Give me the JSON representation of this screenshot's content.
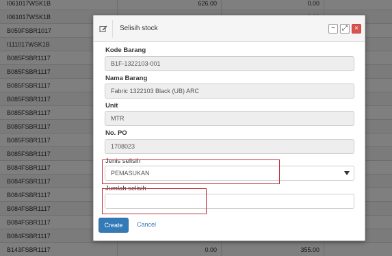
{
  "background": {
    "rows": [
      {
        "code": "I061017WSK1B",
        "v1": "626.00",
        "v2": "0.00"
      },
      {
        "code": "I061017WSK1B",
        "v1": "",
        "v2": "0.00"
      },
      {
        "code": "B059FSBR1017",
        "v1": "",
        "v2": ""
      },
      {
        "code": "I111017WSK1B",
        "v1": "",
        "v2": ""
      },
      {
        "code": "B085FSBR1117",
        "v1": "",
        "v2": ""
      },
      {
        "code": "B085FSBR1117",
        "v1": "",
        "v2": ""
      },
      {
        "code": "B085FSBR1117",
        "v1": "",
        "v2": ""
      },
      {
        "code": "B085FSBR1117",
        "v1": "",
        "v2": ""
      },
      {
        "code": "B085FSBR1117",
        "v1": "",
        "v2": ""
      },
      {
        "code": "B085FSBR1117",
        "v1": "",
        "v2": ""
      },
      {
        "code": "B085FSBR1117",
        "v1": "",
        "v2": ""
      },
      {
        "code": "B085FSBR1117",
        "v1": "",
        "v2": ""
      },
      {
        "code": "B084FSBR1117",
        "v1": "",
        "v2": ""
      },
      {
        "code": "B084FSBR1117",
        "v1": "",
        "v2": ""
      },
      {
        "code": "B084FSBR1117",
        "v1": "",
        "v2": ""
      },
      {
        "code": "B084FSBR1117",
        "v1": "",
        "v2": ""
      },
      {
        "code": "B084FSBR1117",
        "v1": "",
        "v2": ""
      },
      {
        "code": "B084FSBR1117",
        "v1": "",
        "v2": ""
      },
      {
        "code": "B143FSBR1117",
        "v1": "0.00",
        "v2": "355.00"
      }
    ]
  },
  "dialog": {
    "title": "Selisih stock",
    "icon": "edit-icon",
    "buttons": {
      "minimize": "−",
      "maximize": "⤢",
      "close": "×"
    },
    "fields": {
      "kode_barang": {
        "label": "Kode Barang",
        "value": "B1F-1322103-001"
      },
      "nama_barang": {
        "label": "Nama Barang",
        "value": "Fabric 1322103 Black (UB) ARC"
      },
      "unit": {
        "label": "Unit",
        "value": "MTR"
      },
      "no_po": {
        "label": "No. PO",
        "value": "1708023"
      },
      "jenis_selisih": {
        "label": "Jenis selisih",
        "value": "PEMASUKAN"
      },
      "jumlah_selisih": {
        "label": "Jumlah selisih",
        "value": ""
      }
    },
    "actions": {
      "create": "Create",
      "cancel": "Cancel"
    }
  },
  "colors": {
    "primary": "#337ab7",
    "close": "#d9534f",
    "highlight": "#c0303a"
  }
}
